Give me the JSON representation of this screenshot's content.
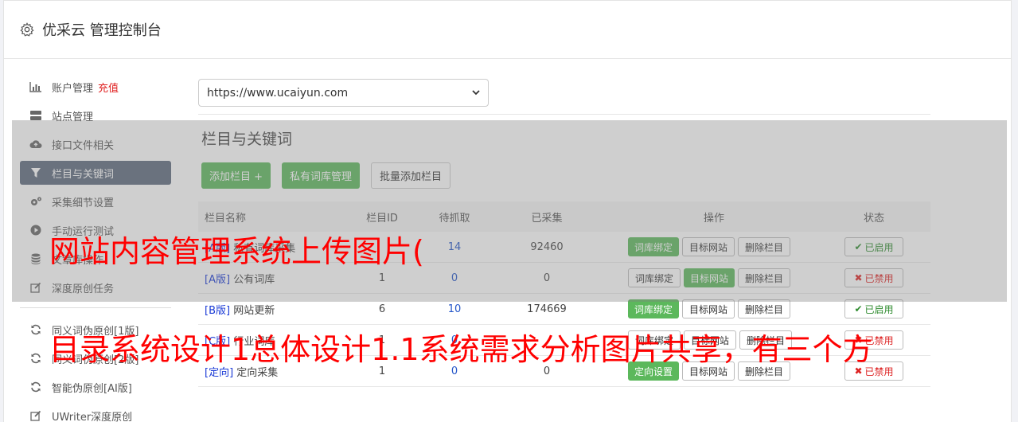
{
  "header": {
    "title": "优采云 管理控制台",
    "icon": "gear-icon"
  },
  "sidebar": {
    "items": [
      {
        "label": "账户管理",
        "extra": "充值",
        "icon": "bar-chart-icon"
      },
      {
        "label": "站点管理",
        "icon": "server-icon"
      },
      {
        "label": "接口文件相关",
        "icon": "cloud-upload-icon"
      },
      {
        "label": "栏目与关键词",
        "icon": "filter-icon",
        "active": true
      },
      {
        "label": "采集细节设置",
        "icon": "gears-icon"
      },
      {
        "label": "手动运行测试",
        "icon": "play-circle-icon"
      },
      {
        "label": "文章库操作",
        "icon": "database-icon"
      },
      {
        "label": "深度原创任务",
        "icon": "edit-icon"
      }
    ],
    "items2": [
      {
        "label": "同义词伪原创[1版]",
        "icon": "refresh-icon"
      },
      {
        "label": "同义词伪原创[2版]",
        "icon": "refresh-icon"
      },
      {
        "label": "智能伪原创[AI版]",
        "icon": "refresh-icon"
      },
      {
        "label": "UWriter深度原创",
        "icon": "edit-icon"
      }
    ]
  },
  "main": {
    "site_select": "https://www.ucaiyun.com",
    "section_title": "栏目与关键词",
    "buttons": {
      "add": "添加栏目 +",
      "private_lib": "私有词库管理",
      "batch_add": "批量添加栏目"
    },
    "table": {
      "headers": {
        "name": "栏目名称",
        "id": "栏目ID",
        "wait": "待抓取",
        "done": "已采集",
        "op": "操作",
        "state": "状态"
      },
      "rows": [
        {
          "tag": "[A版]",
          "name": "私有词库采集",
          "id": "",
          "wait": "14",
          "done": "92460",
          "op1": "词库绑定",
          "op1_green": true,
          "op2": "目标网站",
          "op2_green": false,
          "op3": "删除栏目",
          "state": "已启用",
          "on": true
        },
        {
          "tag": "[A版]",
          "name": "公有词库",
          "id": "1",
          "wait": "0",
          "done": "0",
          "op1": "词库绑定",
          "op1_green": false,
          "op2": "目标网站",
          "op2_green": true,
          "op3": "删除栏目",
          "state": "已禁用",
          "on": false
        },
        {
          "tag": "[B版]",
          "name": "网站更新",
          "id": "6",
          "wait": "10",
          "done": "174669",
          "op1": "词库绑定",
          "op1_green": true,
          "op2": "目标网站",
          "op2_green": false,
          "op3": "删除栏目",
          "state": "已启用",
          "on": true
        },
        {
          "tag": "[C版]",
          "name": "行业词库",
          "id": "1",
          "wait": "0",
          "done": "",
          "op1": "词库绑定",
          "op1_green": false,
          "op2": "目标网站",
          "op2_green": false,
          "op3": "删除栏目",
          "state": "已禁用",
          "on": false
        },
        {
          "tag": "[定向]",
          "name": "定向采集",
          "id": "1",
          "wait": "0",
          "done": "0",
          "op1": "定向设置",
          "op1_green": true,
          "op2": "目标网站",
          "op2_green": false,
          "op3": "删除栏目",
          "state": "已禁用",
          "on": false
        }
      ]
    }
  },
  "watermarks": {
    "line1": "网站内容管理系统上传图片(",
    "line2": "目录系统设计1总体设计1.1系统需求分析图片共享，有三个方"
  },
  "colors": {
    "accent_green": "#5cb85c",
    "active_nav": "#5d6a7d",
    "watermark": "#ff0000",
    "recharge": "#e02020"
  }
}
